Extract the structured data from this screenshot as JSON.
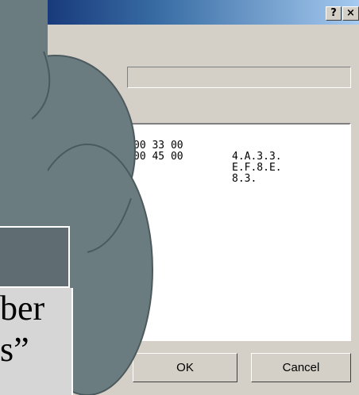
{
  "window": {
    "title": "",
    "help_label": "?",
    "close_label": "×"
  },
  "fields": {
    "text_value": ""
  },
  "hex_view": {
    "rows": [
      {
        "bytes": "00 33 00",
        "ascii": "4.A.3.3."
      },
      {
        "bytes": "00 45 00",
        "ascii": "E.F.8.E."
      },
      {
        "bytes": "",
        "ascii": "8.3."
      }
    ]
  },
  "buttons": {
    "ok_label": "OK",
    "cancel_label": "Cancel"
  },
  "overlay": {
    "note_line1": "ber",
    "note_line2": "s”"
  },
  "colors": {
    "dialog_bg": "#d4d0c8",
    "title_start": "#0a246a",
    "title_end": "#a6caf0",
    "cloud_fill": "#6b7c80",
    "cloud_outline": "#4a5a5e"
  }
}
